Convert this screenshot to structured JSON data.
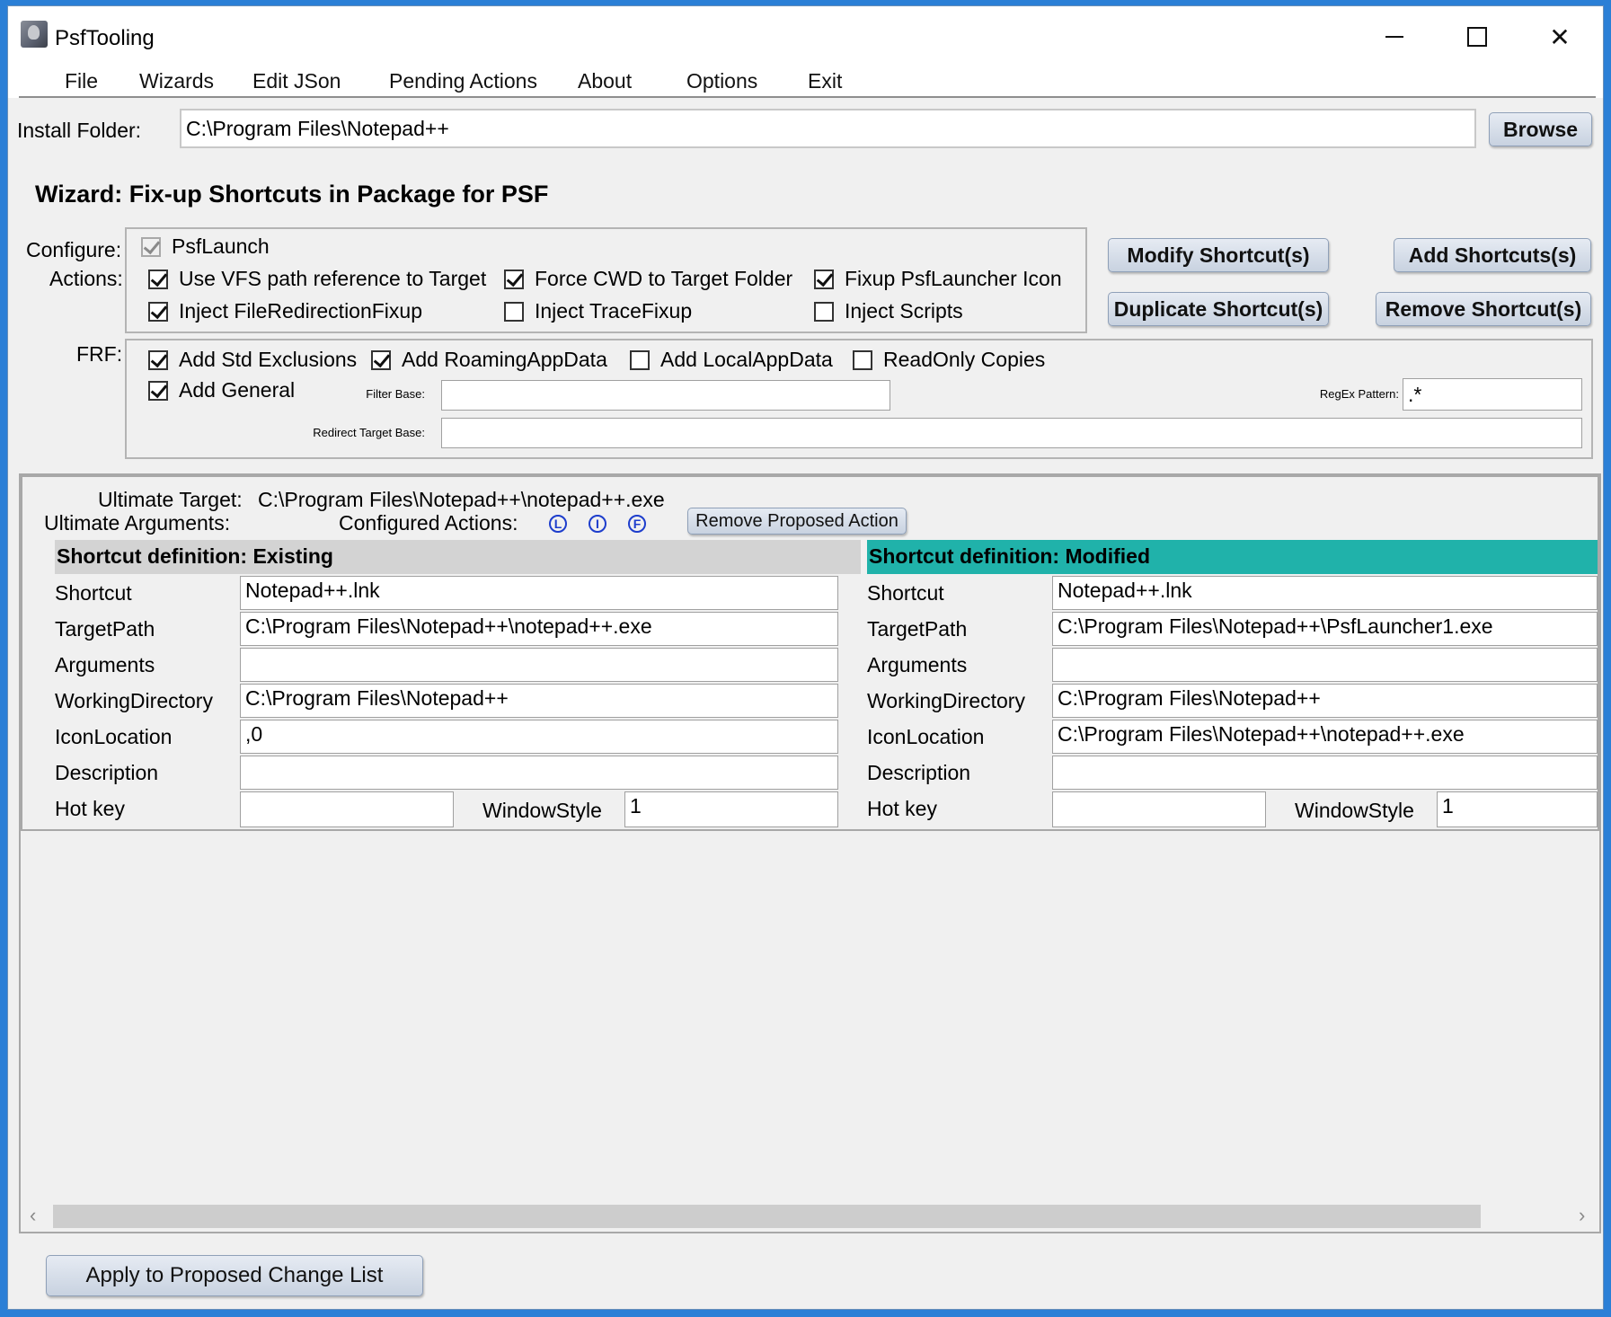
{
  "window": {
    "title": "PsfTooling",
    "controls": {
      "minimize": "—",
      "maximize": "□",
      "close": "✕"
    }
  },
  "menu": [
    "File",
    "Wizards",
    "Edit JSon",
    "Pending Actions",
    "About",
    "Options",
    "Exit"
  ],
  "install": {
    "label": "Install Folder:",
    "value": "C:\\Program Files\\Notepad++",
    "browse_label": "Browse"
  },
  "wizard_title": "Wizard: Fix-up Shortcuts in Package for PSF",
  "configure": {
    "label_line1": "Configure:",
    "label_line2": "Actions:",
    "psflaunch": {
      "label": "PsfLaunch",
      "checked": true,
      "enabled": false
    },
    "options": [
      {
        "label": "Use VFS path reference to Target",
        "checked": true
      },
      {
        "label": "Force CWD to Target Folder",
        "checked": true
      },
      {
        "label": "Fixup PsfLauncher Icon",
        "checked": true
      },
      {
        "label": "Inject FileRedirectionFixup",
        "checked": true
      },
      {
        "label": "Inject TraceFixup",
        "checked": false
      },
      {
        "label": "Inject Scripts",
        "checked": false
      }
    ]
  },
  "actions": {
    "modify": "Modify Shortcut(s)",
    "add": "Add Shortcuts(s)",
    "duplicate": "Duplicate Shortcut(s)",
    "remove": "Remove Shortcut(s)"
  },
  "frf": {
    "label": "FRF:",
    "options": [
      {
        "label": "Add Std Exclusions",
        "checked": true
      },
      {
        "label": "Add RoamingAppData",
        "checked": true
      },
      {
        "label": "Add LocalAppData",
        "checked": false
      },
      {
        "label": "ReadOnly Copies",
        "checked": false
      },
      {
        "label": "Add General",
        "checked": true
      }
    ],
    "filter_base_label": "Filter Base:",
    "filter_base_value": "",
    "regex_label": "RegEx Pattern:",
    "regex_value": ".*",
    "redirect_label": "Redirect Target Base:",
    "redirect_value": ""
  },
  "detail": {
    "ultimate_target_label": "Ultimate Target:",
    "ultimate_target_value": "C:\\Program Files\\Notepad++\\notepad++.exe",
    "ultimate_args_label": "Ultimate Arguments:",
    "configured_actions_label": "Configured Actions:",
    "action_icons": [
      "L",
      "I",
      "F"
    ],
    "remove_proposed_label": "Remove Proposed Action",
    "existing": {
      "header": "Shortcut definition: Existing",
      "header_color": "#d3d3d3",
      "fields": [
        {
          "label": "Shortcut",
          "value": "Notepad++.lnk"
        },
        {
          "label": "TargetPath",
          "value": "C:\\Program Files\\Notepad++\\notepad++.exe"
        },
        {
          "label": "Arguments",
          "value": ""
        },
        {
          "label": "WorkingDirectory",
          "value": "C:\\Program Files\\Notepad++"
        },
        {
          "label": "IconLocation",
          "value": ",0"
        },
        {
          "label": "Description",
          "value": ""
        }
      ],
      "hotkey_label": "Hot key",
      "hotkey_value": "",
      "windowstyle_label": "WindowStyle",
      "windowstyle_value": "1"
    },
    "modified": {
      "header": "Shortcut definition: Modified",
      "header_color": "#20b2aa",
      "fields": [
        {
          "label": "Shortcut",
          "value": "Notepad++.lnk"
        },
        {
          "label": "TargetPath",
          "value": "C:\\Program Files\\Notepad++\\PsfLauncher1.exe"
        },
        {
          "label": "Arguments",
          "value": ""
        },
        {
          "label": "WorkingDirectory",
          "value": "C:\\Program Files\\Notepad++"
        },
        {
          "label": "IconLocation",
          "value": "C:\\Program Files\\Notepad++\\notepad++.exe"
        },
        {
          "label": "Description",
          "value": ""
        }
      ],
      "hotkey_label": "Hot key",
      "hotkey_value": "",
      "windowstyle_label": "WindowStyle",
      "windowstyle_value": "1"
    }
  },
  "scrollbar": {
    "left_arrow": "‹",
    "right_arrow": "›"
  },
  "apply_label": "Apply to Proposed Change List"
}
